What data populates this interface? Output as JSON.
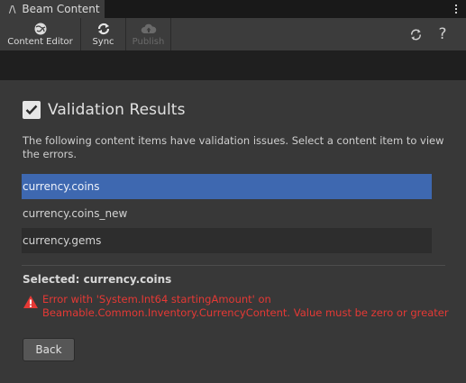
{
  "window": {
    "tab_title": "Beam Content",
    "tab_icon": "beamable-logo-icon"
  },
  "toolbar": {
    "buttons": [
      {
        "label": "Content Editor",
        "icon": "globe-icon",
        "enabled": true
      },
      {
        "label": "Sync",
        "icon": "sync-icon",
        "enabled": true
      },
      {
        "label": "Publish",
        "icon": "cloud-upload-icon",
        "enabled": false
      }
    ],
    "right_icons": [
      "refresh-icon",
      "help-icon"
    ],
    "help_glyph": "?"
  },
  "validation": {
    "checked": true,
    "title": "Validation Results",
    "description": "The following content items have validation issues. Select a content item to view the errors.",
    "items": [
      {
        "label": "currency.coins",
        "selected": true
      },
      {
        "label": "currency.coins_new",
        "selected": false
      },
      {
        "label": "currency.gems",
        "selected": false
      }
    ],
    "selected_label": "Selected: currency.coins",
    "error_text": "Error with 'System.Int64 startingAmount' on Beamable.Common.Inventory.CurrencyContent. Value must be zero or greater",
    "error_color": "#e53935",
    "selection_color": "#3e68b0"
  },
  "actions": {
    "back_label": "Back"
  }
}
